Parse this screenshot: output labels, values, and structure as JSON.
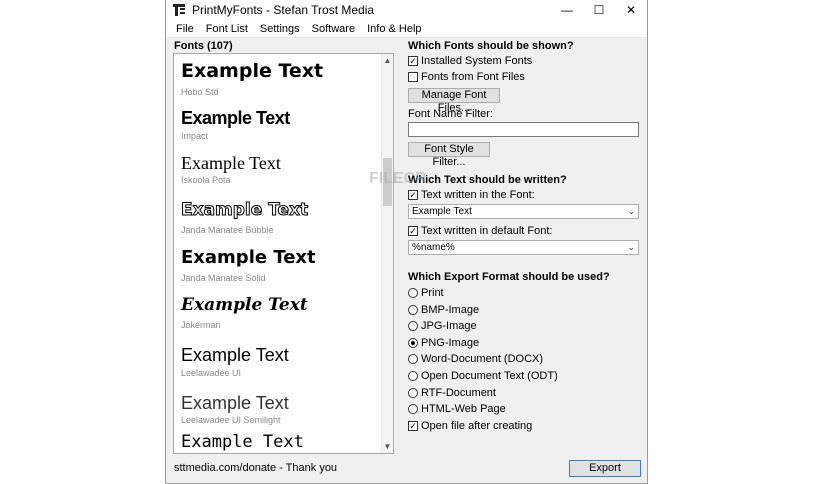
{
  "window": {
    "title": "PrintMyFonts - Stefan Trost Media",
    "controls": {
      "minimize": "—",
      "maximize": "☐",
      "close": "✕"
    }
  },
  "menu": [
    "File",
    "Font List",
    "Settings",
    "Software",
    "Info & Help"
  ],
  "fonts_panel": {
    "header": "Fonts (107)",
    "items": [
      {
        "sample": "Example Text",
        "name": "Hobo Std"
      },
      {
        "sample": "Example Text",
        "name": "Impact"
      },
      {
        "sample": "Example Text",
        "name": "Iskoola Pota"
      },
      {
        "sample": "Example Text",
        "name": "Janda Manatee Bubble"
      },
      {
        "sample": "Example Text",
        "name": "Janda Manatee Solid"
      },
      {
        "sample": "Example Text",
        "name": "Jokerman"
      },
      {
        "sample": "Example Text",
        "name": "Leelawadee UI"
      },
      {
        "sample": "Example Text",
        "name": "Leelawadee UI Semilight"
      },
      {
        "sample": "Example Text",
        "name": ""
      }
    ],
    "scroll_up": "▲",
    "scroll_down": "▼"
  },
  "options": {
    "which_fonts_title": "Which Fonts should be shown?",
    "installed_system_fonts": "Installed System Fonts",
    "installed_system_fonts_checked": true,
    "fonts_from_files": "Fonts from Font Files",
    "fonts_from_files_checked": false,
    "manage_button": "Manage Font Files...",
    "name_filter_label": "Font Name Filter:",
    "name_filter_value": "",
    "style_filter_button": "Font Style Filter...",
    "which_text_title": "Which Text should be written?",
    "text_in_font": "Text written in the Font:",
    "text_in_font_checked": true,
    "text_in_font_value": "Example Text",
    "text_default_font": "Text written in default Font:",
    "text_default_font_checked": true,
    "text_default_font_value": "%name%",
    "export_format_title": "Which Export Format should be used?",
    "formats": [
      "Print",
      "BMP-Image",
      "JPG-Image",
      "PNG-Image",
      "Word-Document (DOCX)",
      "Open Document Text (ODT)",
      "RTF-Document",
      "HTML-Web Page"
    ],
    "selected_format": "PNG-Image",
    "open_after": "Open file after creating",
    "open_after_checked": true
  },
  "footer": {
    "status": "sttmedia.com/donate - Thank you",
    "export_button": "Export"
  },
  "watermark": "FILECR"
}
